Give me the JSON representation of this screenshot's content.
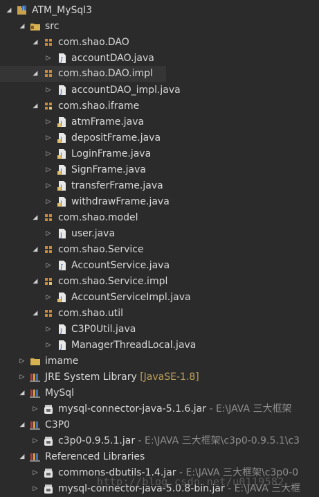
{
  "tree": {
    "project": "ATM_MySql3",
    "src": "src",
    "pkg_dao": "com.shao.DAO",
    "file_accountDAO": "accountDAO.java",
    "pkg_dao_impl": "com.shao.DAO.impl",
    "file_accountDAO_impl": "accountDAO_impl.java",
    "pkg_iframe": "com.shao.iframe",
    "file_atmFrame": "atmFrame.java",
    "file_depositFrame": "depositFrame.java",
    "file_LoginFrame": "LoginFrame.java",
    "file_SignFrame": "SignFrame.java",
    "file_transferFrame": "transferFrame.java",
    "file_withdrawFrame": "withdrawFrame.java",
    "pkg_model": "com.shao.model",
    "file_user": "user.java",
    "pkg_service": "com.shao.Service",
    "file_AccountService": "AccountService.java",
    "pkg_service_impl": "com.shao.Service.impl",
    "file_AccountServiceImpl": "AccountServiceImpl.java",
    "pkg_util": "com.shao.util",
    "file_C3P0Util": "C3P0Util.java",
    "file_ManagerThreadLocal": "ManagerThreadLocal.java",
    "folder_imame": "imame",
    "jre_label": "JRE System Library",
    "jre_decoration": "[JavaSE-1.8]",
    "lib_mysql": "MySql",
    "jar_mysql_516": "mysql-connector-java-5.1.6.jar",
    "jar_mysql_516_path": " - E:\\JAVA 三大框架",
    "lib_c3p0": "C3P0",
    "jar_c3p0": "c3p0-0.9.5.1.jar",
    "jar_c3p0_path": " - E:\\JAVA 三大框架\\c3p0-0.9.5.1\\c3",
    "ref_libs": "Referenced Libraries",
    "jar_dbutils": "commons-dbutils-1.4.jar",
    "jar_dbutils_path": " - E:\\JAVA 三大框架\\c3p0-0",
    "jar_mysql_508": "mysql-connector-java-5.0.8-bin.jar",
    "jar_mysql_508_path": " - E:\\JAVA 三大框"
  },
  "watermark": "http://blog.csdn.net/u0119582"
}
